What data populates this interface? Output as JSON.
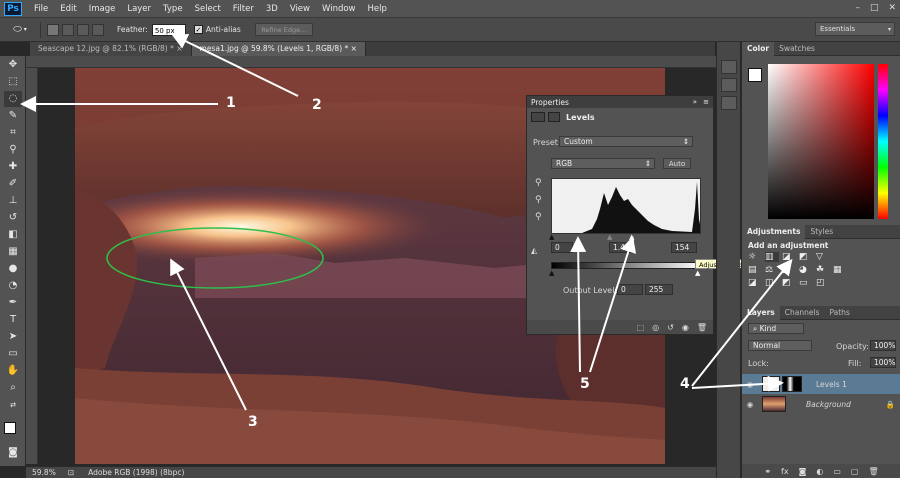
{
  "app": {
    "logo": "Ps"
  },
  "menu": [
    "File",
    "Edit",
    "Image",
    "Layer",
    "Type",
    "Select",
    "Filter",
    "3D",
    "View",
    "Window",
    "Help"
  ],
  "window_controls": [
    "–",
    "□",
    "✕"
  ],
  "options": {
    "feather_label": "Feather:",
    "feather_value": "50 px",
    "antialias_label": "Anti-alias",
    "refine_edge": "Refine Edge...",
    "workspace": "Essentials"
  },
  "tabs": [
    {
      "label": "Seascape 12.jpg @ 82.1% (RGB/8) *",
      "close": "×"
    },
    {
      "label": "mesa1.jpg @ 59.8% (Levels 1, RGB/8) *",
      "close": "×"
    }
  ],
  "status": {
    "zoom": "59.8%",
    "profile": "Adobe RGB (1998) (8bpc)"
  },
  "properties": {
    "title": "Properties",
    "panel_name": "Levels",
    "preset_label": "Preset:",
    "preset_value": "Custom",
    "channel": "RGB",
    "auto_button": "Auto",
    "input_black": "0",
    "input_mid": "1.40",
    "input_white": "154",
    "output_label": "Output Levels:",
    "output_black": "0",
    "output_white": "255"
  },
  "tooltip": "Adjust highlight input level",
  "color_panel": {
    "tabs": [
      "Color",
      "Swatches"
    ]
  },
  "adjustments_panel": {
    "tabs": [
      "Adjustments",
      "Styles"
    ],
    "heading": "Add an adjustment"
  },
  "layers_panel": {
    "tabs": [
      "Layers",
      "Channels",
      "Paths"
    ],
    "filter": "Kind",
    "blend_mode": "Normal",
    "opacity_label": "Opacity:",
    "opacity_value": "100%",
    "lock_label": "Lock:",
    "fill_label": "Fill:",
    "fill_value": "100%",
    "layers": [
      {
        "name": "Levels 1",
        "selected": true
      },
      {
        "name": "Background",
        "selected": false
      }
    ]
  },
  "annotations": [
    "1",
    "2",
    "3",
    "4",
    "5"
  ],
  "colors": {
    "selection_outline": "#2fbf4a",
    "arrow": "#ffffff",
    "selected_layer": "#5b7a93"
  }
}
